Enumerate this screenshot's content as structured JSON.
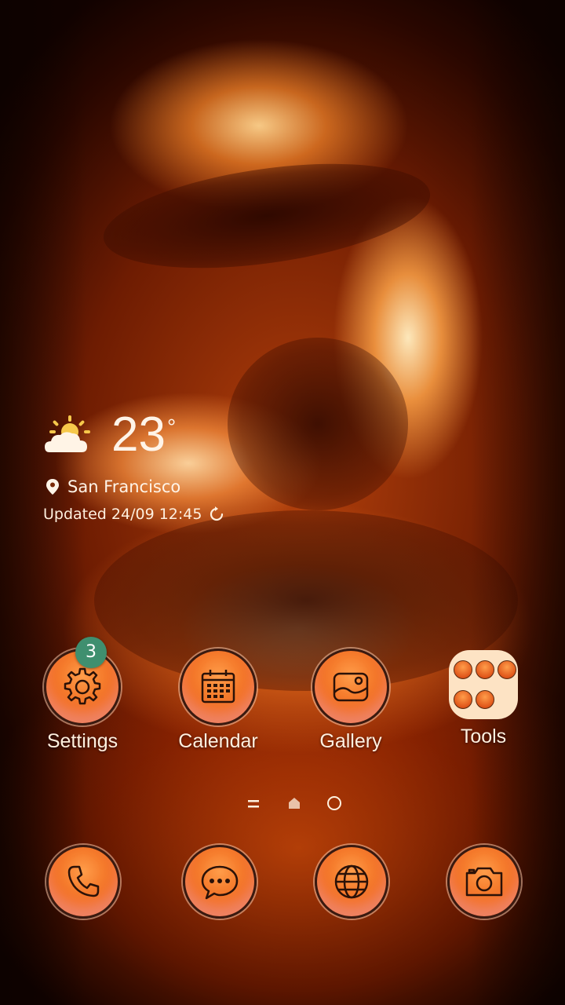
{
  "weather": {
    "temperature": "23",
    "degree_symbol": "°",
    "location": "San Francisco",
    "updated": "Updated 24/09 12:45",
    "condition_icon": "partly-sunny-icon"
  },
  "apps": [
    {
      "label": "Settings",
      "icon": "gear-icon",
      "badge": "3"
    },
    {
      "label": "Calendar",
      "icon": "calendar-icon"
    },
    {
      "label": "Gallery",
      "icon": "gallery-icon"
    },
    {
      "label": "Tools",
      "icon": "folder-icon"
    }
  ],
  "page_indicator": {
    "items": [
      "menu-indicator-icon",
      "home-indicator-icon",
      "page-dot"
    ]
  },
  "dock": [
    {
      "icon": "phone-icon"
    },
    {
      "icon": "messages-icon"
    },
    {
      "icon": "globe-icon"
    },
    {
      "icon": "camera-icon"
    }
  ],
  "colors": {
    "icon_orange": "#f06a1c",
    "badge_green": "#3f8f6f",
    "folder_bg": "#fde3c4",
    "text": "#fff0e0"
  }
}
